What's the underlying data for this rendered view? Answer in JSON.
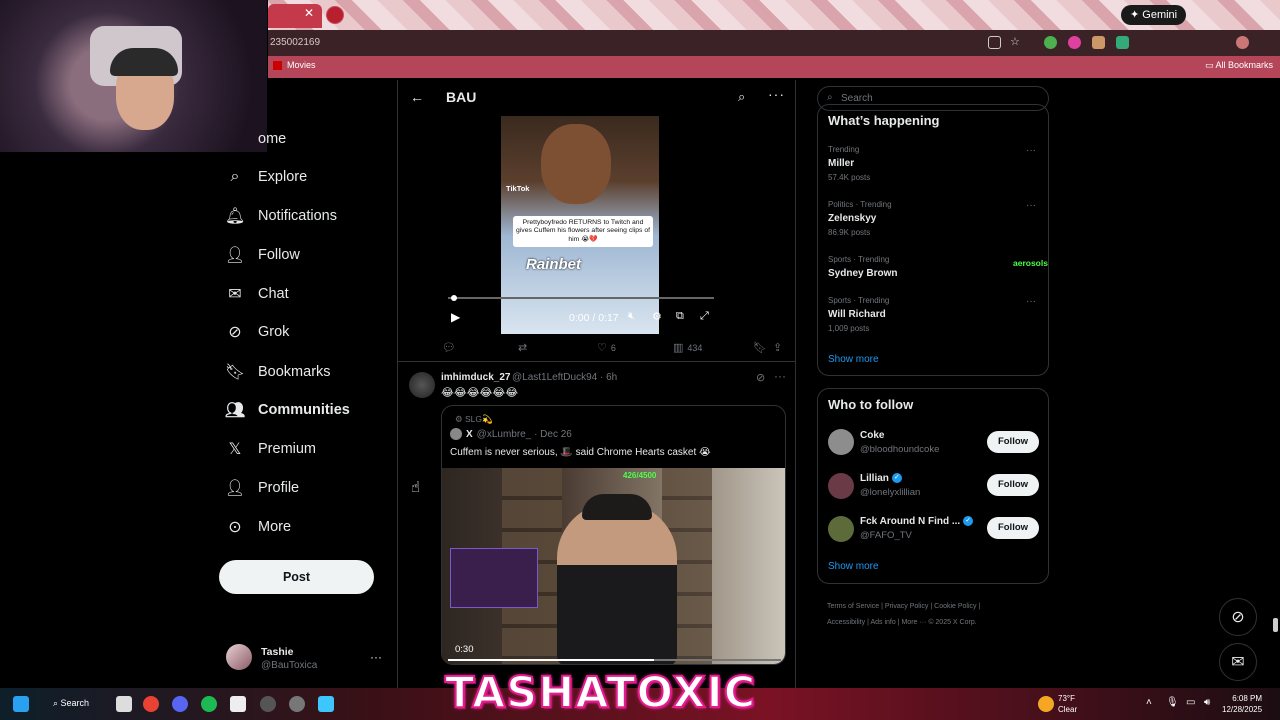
{
  "browser": {
    "url_fragment": "235002169",
    "gemini_label": "Gemini",
    "bookmarks": [
      "Movies"
    ],
    "all_bookmarks": "All Bookmarks"
  },
  "nav": {
    "items": [
      {
        "label": "ome",
        "icon": "home-icon"
      },
      {
        "label": "Explore",
        "icon": "search-icon"
      },
      {
        "label": "Notifications",
        "icon": "bell-icon"
      },
      {
        "label": "Follow",
        "icon": "add-user-icon"
      },
      {
        "label": "Chat",
        "icon": "mail-icon"
      },
      {
        "label": "Grok",
        "icon": "grok-icon"
      },
      {
        "label": "Bookmarks",
        "icon": "bookmark-icon"
      },
      {
        "label": "Communities",
        "icon": "communities-icon"
      },
      {
        "label": "Premium",
        "icon": "x-logo-icon"
      },
      {
        "label": "Profile",
        "icon": "person-icon"
      },
      {
        "label": "More",
        "icon": "more-circle-icon"
      }
    ],
    "post_button": "Post",
    "account": {
      "name": "Tashie",
      "handle": "@BauToxica"
    }
  },
  "main": {
    "title": "BAU",
    "video1": {
      "tiktok_label": "TikTok",
      "caption": "Prettyboyfredo RETURNS to Twitch and gives Cuffem his flowers after seeing clips of him 😭💔",
      "brand": "Rainbet",
      "time": "0:00 / 0:17",
      "progress": 0.0
    },
    "actions": {
      "replies": "",
      "reposts": "",
      "likes": "6",
      "views": "434"
    },
    "tweet2": {
      "name": "imhimduck_27",
      "handle_time": "@Last1LeftDuck94 · 6h",
      "text": "😂😂😂😂😂😂",
      "quote": {
        "context": "SLG💫",
        "author_prefix": "X",
        "author_handle": "@xLumbre_ · Dec 26",
        "text": "Cuffem is never serious, 🎩 said Chrome Hearts casket 😭",
        "overlay_text": "426/4500",
        "video_time": "0:30",
        "progress": 0.62
      }
    }
  },
  "right": {
    "search_placeholder": "Search",
    "happening": {
      "title": "What’s happening",
      "trends": [
        {
          "meta": "Trending",
          "name": "Miller",
          "posts": "57.4K posts"
        },
        {
          "meta": "Politics · Trending",
          "name": "Zelenskyy",
          "posts": "86.9K posts"
        },
        {
          "meta": "Sports · Trending",
          "name": "Sydney Brown",
          "posts": ""
        },
        {
          "meta": "Sports · Trending",
          "name": "Will Richard",
          "posts": "1,009 posts"
        }
      ],
      "show_more": "Show more"
    },
    "who_to_follow": {
      "title": "Who to follow",
      "accounts": [
        {
          "name": "Coke",
          "handle": "@bloodhoundcoke",
          "button": "Follow"
        },
        {
          "name": "Lillian",
          "handle": "@lonelyxlillian",
          "button": "Follow"
        },
        {
          "name": "Fck Around N Find ...",
          "handle": "@FAFO_TV",
          "button": "Follow"
        }
      ],
      "show_more": "Show more"
    },
    "footer": [
      "Terms of Service",
      "Privacy Policy",
      "Cookie Policy",
      "Accessibility",
      "Ads info",
      "More ···",
      "© 2025 X Corp."
    ],
    "stream_overlay": "aerosols"
  },
  "stream_banner": "TASHATOXIC",
  "taskbar": {
    "search_label": "Search",
    "weather_temp": "73°F",
    "weather_desc": "Clear",
    "time": "6:08 PM",
    "date": "12/28/2025"
  },
  "colors": {
    "accent": "#1d9bf0",
    "background": "#000000",
    "banner_outline": "#e41d8f"
  }
}
